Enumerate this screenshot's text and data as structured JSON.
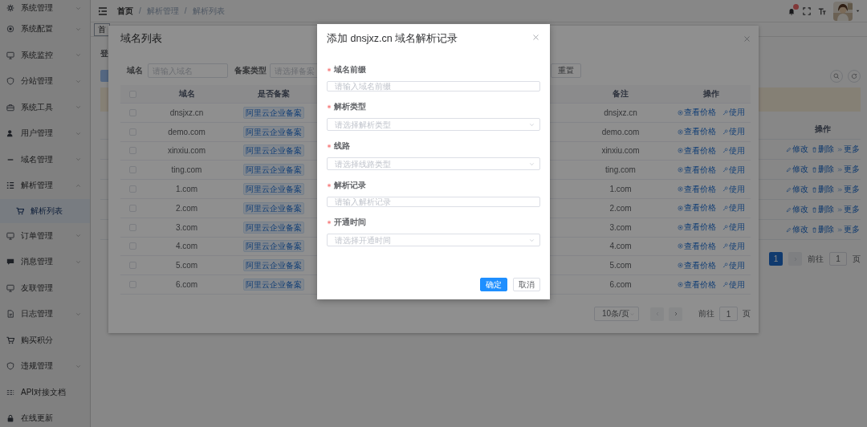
{
  "sidebar": {
    "items": [
      {
        "label": "系统管理",
        "expandable": true,
        "expanded": false,
        "selected": false
      },
      {
        "label": "系统配置",
        "expandable": true,
        "expanded": false,
        "selected": false
      },
      {
        "label": "系统监控",
        "expandable": true,
        "expanded": false,
        "selected": false
      },
      {
        "label": "分站管理",
        "expandable": true,
        "expanded": false,
        "selected": false
      },
      {
        "label": "系统工具",
        "expandable": true,
        "expanded": false,
        "selected": false
      },
      {
        "label": "用户管理",
        "expandable": true,
        "expanded": false,
        "selected": false
      },
      {
        "label": "域名管理",
        "expandable": true,
        "expanded": false,
        "selected": false
      },
      {
        "label": "解析管理",
        "expandable": true,
        "expanded": true,
        "selected": false,
        "children": [
          {
            "label": "解析列表",
            "selected": true
          }
        ]
      },
      {
        "label": "订单管理",
        "expandable": true,
        "expanded": false,
        "selected": false
      },
      {
        "label": "消息管理",
        "expandable": true,
        "expanded": false,
        "selected": false
      },
      {
        "label": "友联管理",
        "expandable": false,
        "selected": false
      },
      {
        "label": "日志管理",
        "expandable": true,
        "expanded": false,
        "selected": false
      },
      {
        "label": "购买积分",
        "expandable": false,
        "selected": false
      },
      {
        "label": "违规管理",
        "expandable": true,
        "expanded": false,
        "selected": false
      },
      {
        "label": "API对接文档",
        "expandable": false,
        "selected": false
      },
      {
        "label": "在线更新",
        "expandable": false,
        "selected": false
      }
    ]
  },
  "header": {
    "breadcrumb": [
      {
        "label": "首页"
      },
      {
        "separator": "/",
        "label": "解析管理"
      },
      {
        "separator": "/",
        "label": "解析列表"
      }
    ]
  },
  "tabs": [
    {
      "label": "首",
      "selected": true
    }
  ],
  "page": {
    "form_label": "登",
    "table": {
      "columns": [
        "操作"
      ],
      "rows": [
        {
          "actions": [
            {
              "kind": "edit",
              "label": "修改"
            },
            {
              "kind": "delete",
              "label": "删除"
            },
            {
              "kind": "more",
              "label": "更多"
            }
          ]
        },
        {
          "actions": [
            {
              "kind": "edit",
              "label": "修改"
            },
            {
              "kind": "delete",
              "label": "删除"
            },
            {
              "kind": "more",
              "label": "更多"
            }
          ]
        },
        {
          "actions": [
            {
              "kind": "edit",
              "label": "修改"
            },
            {
              "kind": "delete",
              "label": "删除"
            },
            {
              "kind": "more",
              "label": "更多"
            }
          ]
        },
        {
          "actions": [
            {
              "kind": "edit",
              "label": "修改"
            },
            {
              "kind": "delete",
              "label": "删除"
            },
            {
              "kind": "more",
              "label": "更多"
            }
          ]
        },
        {
          "actions": [
            {
              "kind": "edit",
              "label": "修改"
            },
            {
              "kind": "delete",
              "label": "删除"
            },
            {
              "kind": "more",
              "label": "更多"
            }
          ]
        }
      ]
    },
    "pagination": {
      "pages": [
        {
          "label": "1",
          "selected": true
        }
      ],
      "goto_label": "前往",
      "goto_value": "1",
      "unit": "页"
    }
  },
  "domain_dialog": {
    "title": "域名列表",
    "filters": [
      {
        "label": "域名",
        "placeholder": "请输入域名"
      },
      {
        "label": "备案类型",
        "placeholder": "请选择备案"
      }
    ],
    "reset_button": "重置",
    "table": {
      "select_all_checked": false,
      "columns": [
        "域名",
        "是否备案",
        "备注",
        "操作"
      ],
      "rows": [
        {
          "checked": false,
          "domain": "dnsjxz.cn",
          "filing": "阿里云企业备案",
          "note": "dnsjxz.cn",
          "actions": [
            {
              "kind": "price",
              "label": "查看价格"
            },
            {
              "kind": "use",
              "label": "使用"
            }
          ]
        },
        {
          "checked": false,
          "domain": "demo.com",
          "filing": "阿里云企业备案",
          "note": "demo.com",
          "actions": [
            {
              "kind": "price",
              "label": "查看价格"
            },
            {
              "kind": "use",
              "label": "使用"
            }
          ]
        },
        {
          "checked": false,
          "domain": "xinxiu.com",
          "filing": "阿里云企业备案",
          "note": "xinxiu.com",
          "actions": [
            {
              "kind": "price",
              "label": "查看价格"
            },
            {
              "kind": "use",
              "label": "使用"
            }
          ]
        },
        {
          "checked": false,
          "domain": "ting.com",
          "filing": "阿里云企业备案",
          "note": "ting.com",
          "actions": [
            {
              "kind": "price",
              "label": "查看价格"
            },
            {
              "kind": "use",
              "label": "使用"
            }
          ]
        },
        {
          "checked": false,
          "domain": "1.com",
          "filing": "阿里云企业备案",
          "note": "1.com",
          "actions": [
            {
              "kind": "price",
              "label": "查看价格"
            },
            {
              "kind": "use",
              "label": "使用"
            }
          ]
        },
        {
          "checked": false,
          "domain": "2.com",
          "filing": "阿里云企业备案",
          "note": "2.com",
          "actions": [
            {
              "kind": "price",
              "label": "查看价格"
            },
            {
              "kind": "use",
              "label": "使用"
            }
          ]
        },
        {
          "checked": false,
          "domain": "3.com",
          "filing": "阿里云企业备案",
          "note": "3.com",
          "actions": [
            {
              "kind": "price",
              "label": "查看价格"
            },
            {
              "kind": "use",
              "label": "使用"
            }
          ]
        },
        {
          "checked": false,
          "domain": "4.com",
          "filing": "阿里云企业备案",
          "note": "4.com",
          "actions": [
            {
              "kind": "price",
              "label": "查看价格"
            },
            {
              "kind": "use",
              "label": "使用"
            }
          ]
        },
        {
          "checked": false,
          "domain": "5.com",
          "filing": "阿里云企业备案",
          "note": "5.com",
          "actions": [
            {
              "kind": "price",
              "label": "查看价格"
            },
            {
              "kind": "use",
              "label": "使用"
            }
          ]
        },
        {
          "checked": false,
          "domain": "6.com",
          "filing": "阿里云企业备案",
          "note": "6.com",
          "actions": [
            {
              "kind": "price",
              "label": "查看价格"
            },
            {
              "kind": "use",
              "label": "使用"
            }
          ]
        }
      ]
    },
    "pagination": {
      "page_size": "10条/页",
      "goto_label": "前往",
      "goto_value": "1",
      "unit": "页"
    }
  },
  "record_dialog": {
    "title": "添加 dnsjxz.cn 域名解析记录",
    "fields": [
      {
        "label": "域名前缀",
        "kind": "input",
        "required": true,
        "placeholder": "请输入域名前缀"
      },
      {
        "label": "解析类型",
        "kind": "select",
        "required": true,
        "placeholder": "请选择解析类型"
      },
      {
        "label": "线路",
        "kind": "select",
        "required": true,
        "placeholder": "请选择线路类型"
      },
      {
        "label": "解析记录",
        "kind": "input",
        "required": true,
        "placeholder": "请输入解析记录"
      },
      {
        "label": "开通时间",
        "kind": "select",
        "required": true,
        "placeholder": "请选择开通时间"
      }
    ],
    "buttons": [
      {
        "kind": "primary",
        "label": "确定"
      },
      {
        "kind": "default",
        "label": "取消"
      }
    ]
  }
}
